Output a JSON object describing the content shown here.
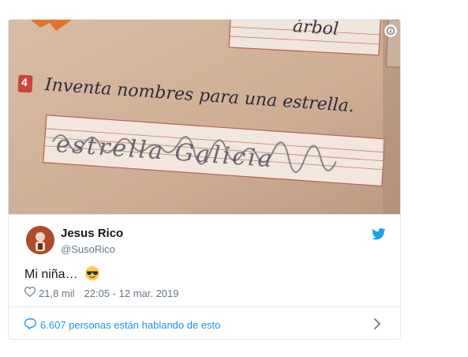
{
  "tweet": {
    "author_name": "Jesus Rico",
    "author_handle": "@SusoRico",
    "text": "Mi niña…",
    "emoji_icon": "sunglasses-emoji-icon",
    "likes": "21,8 mil",
    "timestamp": "22:05 - 12 mar. 2019",
    "conversation": "6.607 personas están hablando de esto"
  },
  "media": {
    "exercise_number": "4",
    "prompt": "Inventa nombres para una estrella.",
    "answer": "estrella Galicia",
    "top_word": "árbol"
  },
  "colors": {
    "accent": "#1da1f2",
    "link": "#1b95e0",
    "muted": "#657786",
    "border": "#e1e8ed"
  }
}
